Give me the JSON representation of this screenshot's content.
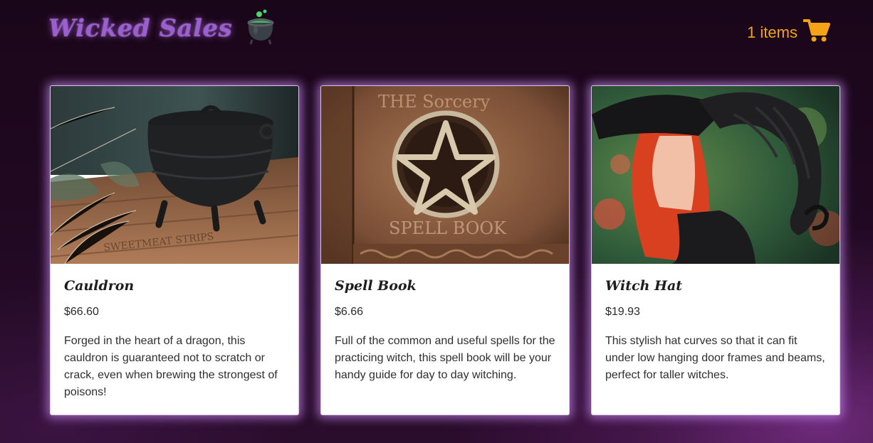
{
  "header": {
    "brand_title": "Wicked Sales",
    "cart_label": "1 items"
  },
  "icons": {
    "logo": "cauldron-icon",
    "cart": "shopping-cart-icon"
  },
  "colors": {
    "brand": "#9b5fd0",
    "cart": "#f5a316",
    "card_glow": "#be82e6"
  },
  "products": [
    {
      "name": "Cauldron",
      "price": "$66.60",
      "description": "Forged in the heart of a dragon, this cauldron is guaranteed not to scratch or crack, even when brewing the strongest of poisons!"
    },
    {
      "name": "Spell Book",
      "price": "$6.66",
      "description": "Full of the common and useful spells for the practicing witch, this spell book will be your handy guide for day to day witching."
    },
    {
      "name": "Witch Hat",
      "price": "$19.93",
      "description": "This stylish hat curves so that it can fit under low hanging door frames and beams, perfect for taller witches."
    }
  ]
}
